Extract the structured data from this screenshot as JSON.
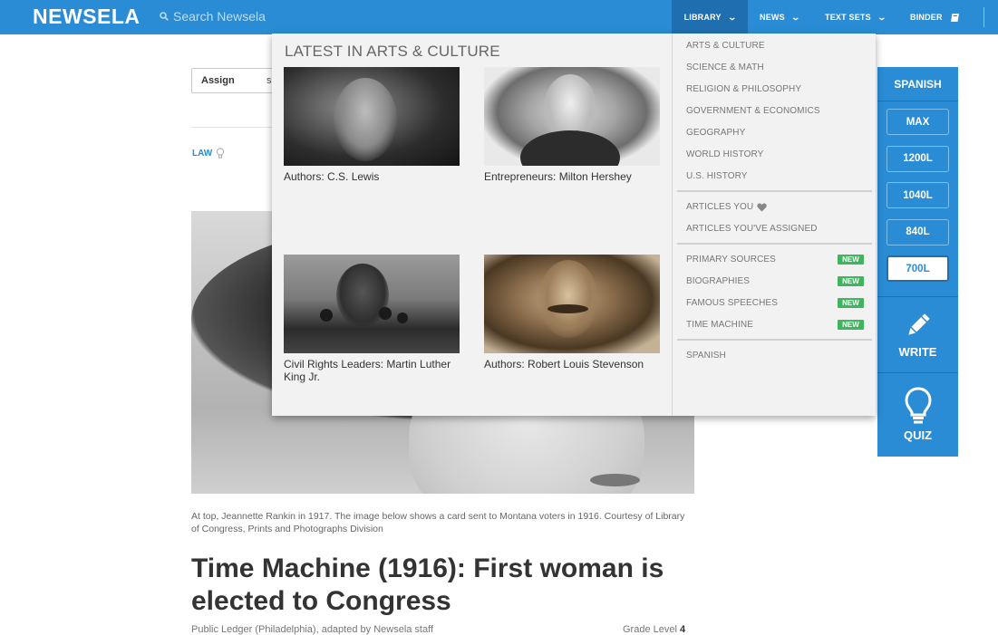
{
  "app": {
    "logo": "NEWSELA",
    "search_placeholder": "Search Newsela"
  },
  "nav": {
    "library": "LIBRARY",
    "news": "NEWS",
    "text_sets": "TEXT SETS",
    "binder": "BINDER"
  },
  "article": {
    "assign_label": "Assign",
    "assign_extra": "s",
    "topic": "LAW",
    "caption": "At top, Jeannette Rankin in 1917. The image below shows a card sent to Montana voters in 1916. Courtesy of Library of Congress, Prints and Photographs Division",
    "headline": "Time Machine (1916): First woman is elected to Congress",
    "byline": "Public Ledger (Philadelphia), adapted by Newsela staff",
    "grade_label": "Grade Level",
    "grade_value": "4"
  },
  "sidebar": {
    "language": "SPANISH",
    "levels": [
      "MAX",
      "1200L",
      "1040L",
      "840L",
      "700L"
    ],
    "selected_level": "700L",
    "write_label": "WRITE",
    "quiz_label": "QUIZ"
  },
  "dropdown": {
    "title": "LATEST IN ARTS & CULTURE",
    "cards": [
      {
        "caption": "Authors: C.S. Lewis"
      },
      {
        "caption": "Entrepreneurs: Milton Hershey"
      },
      {
        "caption": "Civil Rights Leaders: Martin Luther King Jr."
      },
      {
        "caption": "Authors: Robert Louis Stevenson"
      }
    ],
    "categories": [
      "ARTS & CULTURE",
      "SCIENCE & MATH",
      "RELIGION & PHILOSOPHY",
      "GOVERNMENT & ECONOMICS",
      "GEOGRAPHY",
      "WORLD HISTORY",
      "U.S. HISTORY"
    ],
    "personal": {
      "articles_you": "ARTICLES YOU",
      "assigned": "ARTICLES YOU'VE ASSIGNED"
    },
    "collections": [
      {
        "label": "PRIMARY SOURCES",
        "badge": "NEW"
      },
      {
        "label": "BIOGRAPHIES",
        "badge": "NEW"
      },
      {
        "label": "FAMOUS SPEECHES",
        "badge": "NEW"
      },
      {
        "label": "TIME MACHINE",
        "badge": "NEW"
      }
    ],
    "spanish": "SPANISH"
  },
  "colors": {
    "brand_blue": "#2a8cd4",
    "new_badge": "#3fb55f"
  }
}
